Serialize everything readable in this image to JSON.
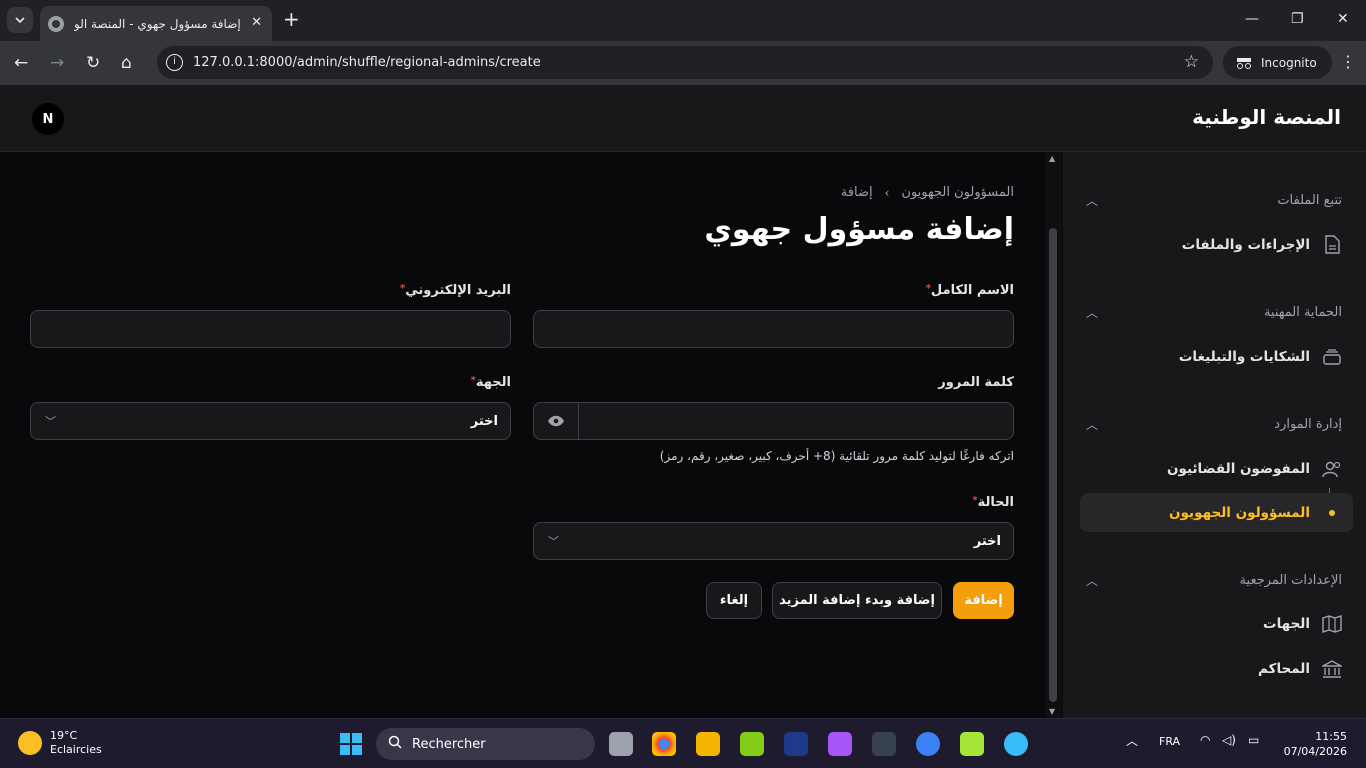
{
  "browser": {
    "tab_title": "إضافة مسؤول جهوي - المنصة الو",
    "url": "127.0.0.1:8000/admin/shuffle/regional-admins/create",
    "incognito_label": "Incognito"
  },
  "header": {
    "brand": "المنصة الوطنية",
    "avatar_initial": "N"
  },
  "sidebar": {
    "groups": [
      {
        "label": "تتبع الملفات",
        "items": [
          {
            "label": "الإجراءات والملفات",
            "icon": "document-icon"
          }
        ]
      },
      {
        "label": "الحماية المهنية",
        "items": [
          {
            "label": "الشكايات والتبليغات",
            "icon": "inbox-stack-icon"
          }
        ]
      },
      {
        "label": "إدارة الموارد",
        "items": [
          {
            "label": "المفوضون القضائيون",
            "icon": "users-icon"
          },
          {
            "label": "المسؤولون الجهويون",
            "icon": "dot-icon",
            "active": true
          }
        ]
      },
      {
        "label": "الإعدادات المرجعية",
        "items": [
          {
            "label": "الجهات",
            "icon": "map-icon"
          },
          {
            "label": "المحاكم",
            "icon": "building-library-icon"
          }
        ]
      }
    ]
  },
  "main": {
    "breadcrumb": [
      "المسؤولون الجهويون",
      "إضافة"
    ],
    "title": "إضافة مسؤول جهوي",
    "fields": {
      "full_name": {
        "label": "الاسم الكامل",
        "value": ""
      },
      "email": {
        "label": "البريد الإلكتروني",
        "value": ""
      },
      "password": {
        "label": "كلمة المرور",
        "value": "",
        "hint": "اتركه فارغًا لتوليد كلمة مرور تلقائية (8+ أحرف، كبير، صغير، رقم، رمز)"
      },
      "region": {
        "label": "الجهة",
        "selected": "اختر"
      },
      "status": {
        "label": "الحالة",
        "selected": "اختر"
      }
    },
    "buttons": {
      "create": "إضافة",
      "create_another": "إضافة وبدء إضافة المزيد",
      "cancel": "إلغاء"
    }
  },
  "taskbar": {
    "weather_temp": "19°C",
    "weather_desc": "Eclaircies",
    "search_label": "Rechercher",
    "lang": "FRA",
    "time": "11:55",
    "date": "07/04/2026"
  },
  "colors": {
    "accent": "#f59e0b",
    "active_text": "#fbbf24",
    "sidebar_bg": "#18181b",
    "page_bg": "#09090b"
  }
}
